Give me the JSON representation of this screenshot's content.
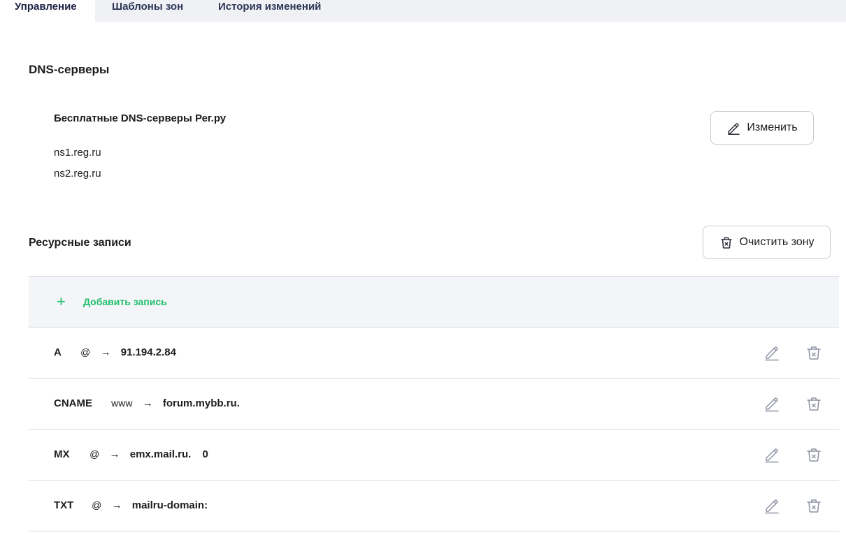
{
  "tabs": [
    {
      "label": "Управление",
      "active": true
    },
    {
      "label": "Шаблоны зон",
      "active": false
    },
    {
      "label": "История изменений",
      "active": false
    }
  ],
  "dns_servers": {
    "title": "DNS-серверы",
    "block_title": "Бесплатные DNS-серверы Рег.ру",
    "servers": [
      "ns1.reg.ru",
      "ns2.reg.ru"
    ],
    "change_button": {
      "label": "Изменить",
      "icon": "pencil-icon"
    }
  },
  "resource_records": {
    "title": "Ресурсные записи",
    "clear_button": {
      "label": "Очистить зону",
      "icon": "trash-icon"
    },
    "add_label": "Добавить запись",
    "add_icon": "plus-icon",
    "arrow": "→",
    "records": [
      {
        "type": "A",
        "name": "@",
        "value": "91.194.2.84",
        "priority": ""
      },
      {
        "type": "CNAME",
        "name": "www",
        "value": "forum.mybb.ru.",
        "priority": ""
      },
      {
        "type": "MX",
        "name": "@",
        "value": "emx.mail.ru.",
        "priority": "0"
      },
      {
        "type": "TXT",
        "name": "@",
        "value": "mailru-domain:",
        "priority": ""
      }
    ]
  },
  "colors": {
    "accent_green": "#22c06c",
    "tab_bar": "#eff1f5",
    "icon_gray": "#8e92a3"
  }
}
